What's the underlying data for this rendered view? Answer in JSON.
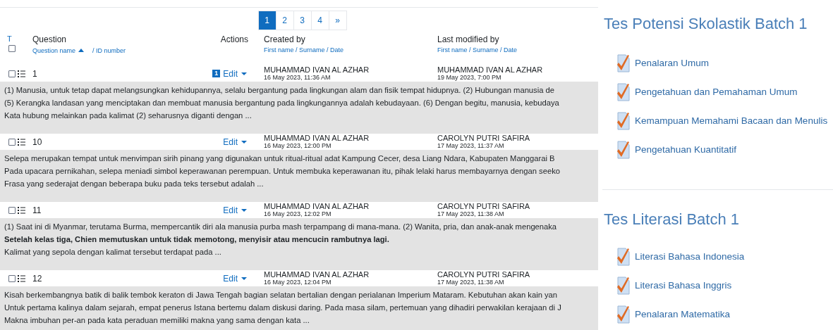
{
  "pagination": [
    {
      "label": "1",
      "selected": true
    },
    {
      "label": "2",
      "selected": false
    },
    {
      "label": "3",
      "selected": false
    },
    {
      "label": "4",
      "selected": false
    },
    {
      "label": "»",
      "selected": false
    }
  ],
  "table": {
    "type_column": "T",
    "question_heading": "Question",
    "question_sort_name": "Question name",
    "question_sort_id": "/ ID number",
    "actions_heading": "Actions",
    "created_heading": "Created by",
    "created_sub": "First name / Surname / Date",
    "modified_heading": "Last modified by",
    "modified_sub": "First name / Surname / Date",
    "select_all_checked": false,
    "rows": [
      {
        "name": "1",
        "checked": false,
        "version_badge": "1",
        "action": "Edit",
        "created_by": "MUHAMMAD IVAN AL AZHAR",
        "created_date": "16 May 2023, 11:36 AM",
        "modified_by": "MUHAMMAD IVAN AL AZHAR",
        "modified_date": "19 May 2023, 7:00 PM",
        "lines": [
          {
            "text": "(1) Manusia, untuk tetap dapat melangsungkan kehidupannya, selalu bergantung pada lingkungan alam dan fisik tempat hidupnya. (2) Hubungan manusia de",
            "bold": false
          },
          {
            "text": "(5) Kerangka landasan yang menciptakan dan membuat manusia bergantung pada lingkungannya adalah kebudayaan. (6) Dengan begitu, manusia, kebudaya",
            "bold": false
          },
          {
            "text": "Kata hubung melainkan pada kalimat (2) seharusnya diganti dengan ...",
            "bold": false
          }
        ]
      },
      {
        "name": "10",
        "checked": false,
        "action": "Edit",
        "created_by": "MUHAMMAD IVAN AL AZHAR",
        "created_date": "16 May 2023, 12:00 PM",
        "modified_by": "CAROLYN PUTRI SAFIRA",
        "modified_date": "17 May 2023, 11:37 AM",
        "lines": [
          {
            "text": "Selepa merupakan tempat untuk menvimpan sirih pinang yang digunakan untuk ritual-ritual adat Kampung Cecer, desa Liang Ndara, Kabupaten Manggarai B",
            "bold": false
          },
          {
            "text": "Pada upacara pernikahan, selepa meniadi simbol keperawanan perempuan. Untuk membuka keperawanan itu, pihak lelaki harus membayarnya dengan seeko",
            "bold": false
          },
          {
            "text": "Frasa yang sederajat dengan beberapa buku pada teks tersebut adalah ...",
            "bold": false
          }
        ]
      },
      {
        "name": "11",
        "checked": false,
        "action": "Edit",
        "created_by": "MUHAMMAD IVAN AL AZHAR",
        "created_date": "16 May 2023, 12:02 PM",
        "modified_by": "CAROLYN PUTRI SAFIRA",
        "modified_date": "17 May 2023, 11:38 AM",
        "lines": [
          {
            "text": "(1) Saat ini di Myanmar, terutama Burma, mempercantik diri ala manusia purba mash terpampang di mana-mana. (2) Wanita, pria, dan anak-anak mengenaka",
            "bold": false
          },
          {
            "text": "Setelah kelas tiga, Chien memutuskan untuk tidak memotong, menyisir atau mencucin rambutnya lagi.",
            "bold": true
          },
          {
            "text": "Kalimat yang sepola dengan kalimat tersebut terdapat pada ...",
            "bold": false
          }
        ]
      },
      {
        "name": "12",
        "checked": false,
        "action": "Edit",
        "created_by": "MUHAMMAD IVAN AL AZHAR",
        "created_date": "16 May 2023, 12:04 PM",
        "modified_by": "CAROLYN PUTRI SAFIRA",
        "modified_date": "17 May 2023, 11:38 AM",
        "lines": [
          {
            "text": "Kisah berkembangnya batik di balik tembok keraton di Jawa Tengah bagian selatan bertalian dengan perialanan Imperium Mataram. Kebutuhan akan kain yan",
            "bold": false
          },
          {
            "text": "Untuk pertama kalinya dalam sejarah, empat penerus Istana bertemu dalam diskusi daring. Pada masa silam, pertemuan yang dihadiri perwakilan kerajaan di J",
            "bold": false
          },
          {
            "text": "Makna imbuhan per-an pada kata peraduan memiliki makna yang sama dengan kata ...",
            "bold": false
          }
        ]
      }
    ]
  },
  "sections": [
    {
      "title": "Tes Potensi Skolastik Batch 1",
      "items": [
        "Penalaran Umum",
        "Pengetahuan dan Pemahaman Umum",
        "Kemampuan Memahami Bacaan dan Menulis",
        "Pengetahuan Kuantitatif"
      ]
    },
    {
      "title": "Tes Literasi Batch 1",
      "items": [
        "Literasi Bahasa Indonesia",
        "Literasi Bahasa Inggris",
        "Penalaran Matematika"
      ]
    }
  ]
}
